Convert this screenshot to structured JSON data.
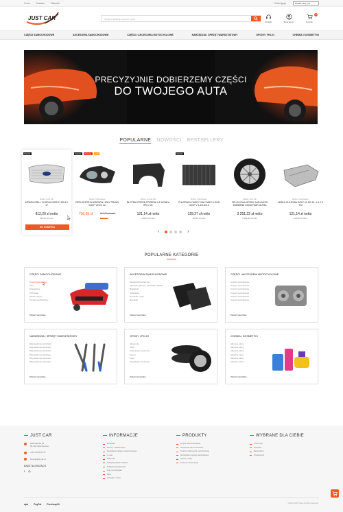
{
  "topbar": {
    "links": [
      "O nas",
      "Dostawa",
      "Płatności"
    ],
    "language": "Zmień język",
    "currency": "Polskie złoty (zł)"
  },
  "header": {
    "logo_text": "JUST CAR",
    "search_placeholder": "Szukaj w katalogu naszych części...",
    "icons": [
      {
        "icon": "headset-icon",
        "label": "Kontakt"
      },
      {
        "icon": "user-icon",
        "label": "Moje konto"
      },
      {
        "icon": "cart-icon",
        "label": "Koszyk",
        "badge": "0"
      }
    ]
  },
  "nav": {
    "items": [
      "CZĘŚCI SAMOCHODOWE",
      "AKCESORIA SAMOCHODOWE",
      "CZĘŚCI I AKCESORIA MOTOCYKLOWE",
      "NARZĘDZIA I SPRZĘT WARSZTATOWY",
      "OPONY I FELGI",
      "CHEMIA I KOSMETYKI"
    ]
  },
  "banner": {
    "line1": "PRECYZYJNIE DOBIERZEMY CZĘŚCI",
    "line2": "DO TWOJEGO AUTA"
  },
  "product_tabs": [
    "POPULARNE",
    "NOWOŚCI",
    "BESTSELLERY"
  ],
  "products": [
    {
      "tags": [
        "Nowość"
      ],
      "brand": "Marka: Ford OE",
      "name": "ATRAPA GRILL CHROM FORD F-150 15-17",
      "price": "812,20 zł netto",
      "gross": "999,01 zł brutto",
      "cart": "DO KOSZYKA"
    },
    {
      "tags": [
        "Nowość",
        "Promocja",
        "-15%"
      ],
      "brand": "Marka: Volkswagen",
      "name": "REFLEKTOR BI-KSENON LEWY PRAWY GOLF VII 5G 12-",
      "price": "736,99 zł",
      "old_price": "812,20 zł netto",
      "old_gross": "999,01 zł"
    },
    {
      "tags": [],
      "brand": "Marka: Honda OE",
      "name": "BŁOTNIK PRZÓD PRZEDNI L/P HONDA HR-V 15-",
      "price": "121,14 zł netto",
      "gross": "149,00 zł brutto"
    },
    {
      "tags": [
        "Nowość"
      ],
      "brand": "Marka: Volkswagen",
      "name": "CHŁODNICA WODY VW CADDY LEON GOLF V 1.4/1.6/2.0",
      "price": "129,27 zł netto",
      "gross": "159,00 zł brutto"
    },
    {
      "tags": [],
      "brand": "Marka: Audi OE",
      "name": "FELGI KOŁA OPONY AUDI A8 D5 235/55R18 GOODYEAR ULTRA",
      "price": "3 251,22 zł netto",
      "gross": "3 999,00 zł brutto"
    },
    {
      "tags": [],
      "brand": "Marka: Volkswagen",
      "name": "MISKA OLEJOWA GOLF VII 5G 12- 1.4 2.0 TDI",
      "price": "121,14 zł netto",
      "gross": "149,00 zł brutto"
    }
  ],
  "categories_title": "POPULARNE KATEGORIE",
  "categories": [
    {
      "title": "CZĘŚCI SAMOCHODOWE",
      "items": [
        "Części blacharskie",
        "Filtry",
        "Oświetlenie",
        "Pozostałe",
        "Silniki i części",
        "Tuning mechaniczny"
      ],
      "all": "Zobacz wszystkie"
    },
    {
      "title": "AKCESORIA SAMOCHODOWE",
      "items": [
        "Akcesoria zewnętrzne",
        "Apteczki, gaśnice, kamizelki, trójkąty",
        "Bagażniki",
        "Chlapacze",
        "Dywaniki i maty",
        "Dywaniki"
      ],
      "all": "Zobacz wszystkie"
    },
    {
      "title": "CZĘŚCI I AKCESORIA MOTOCYKLOWE",
      "items": [
        "Części motocyklowe",
        "Części motocyklowe",
        "Części motocyklowe",
        "Części motocyklowe",
        "Części motocyklowe",
        "Części motocyklowe"
      ],
      "all": "Zobacz wszystkie"
    },
    {
      "title": "NARZĘDZIA I SPRZĘT WARSZTATOWY",
      "items": [
        "Wyposażenie warsztatu",
        "Wyposażenie warsztatu",
        "Wyposażenie warsztatu",
        "Wyposażenie warsztatu",
        "Wyposażenie warsztatu",
        "Wyposażenie warsztatu"
      ],
      "all": "Zobacz wszystkie"
    },
    {
      "title": "OPONY I FELGI",
      "items": [
        "Akcesoria",
        "Felgi",
        "Koła (felgi z oponami)",
        "Opony",
        "Felgi",
        "Koła (felgi z oponami)"
      ],
      "all": "Zobacz wszystkie"
    },
    {
      "title": "CHEMIA I KOSMETYKI",
      "items": [
        "Aktywne piany",
        "Aktywne piany",
        "Aktywne piany",
        "Aktywne piany",
        "Aktywne piany",
        "Aktywne piany"
      ],
      "all": "Zobacz wszystkie"
    }
  ],
  "footer": {
    "company": {
      "title": "JUST CAR",
      "address1": "Bukowiecka 56",
      "address2": "86-300 Skierniewice",
      "phone": "+48 799 364 374",
      "email": "biuro@just-car.pl",
      "follow": "BĄDŹ NA BIEŻĄCO"
    },
    "info": {
      "title": "INFORMACJE",
      "items": [
        "Dostawa",
        "Zwroty i Reklamacje",
        "Regulamin sklepu internetowego",
        "O nas",
        "Płatności",
        "Polityka plików cookies",
        "Polityka prywatności",
        "Kup na Kamyam",
        "Blog",
        "Kontakt z nami"
      ]
    },
    "products": {
      "title": "PRODUKTY",
      "items": [
        "Części samochodowe",
        "Akcesoria samochodowe",
        "Części i akcesoria motocyklowe",
        "Narzędzia i sprzęt warsztatowy",
        "Opony i felgi",
        "Chemia i kosmetyki"
      ]
    },
    "choose": {
      "title": "WYBRANE DLA CIEBIE",
      "items": [
        "Promocje",
        "Nowości",
        "Bestsellery",
        "Producenci"
      ]
    },
    "payments": [
      "dpd",
      "PayPal",
      "Przelewy24"
    ],
    "copyright": "© 2021 JUST CAR. All rights reserved."
  },
  "colors": {
    "accent": "#ef5a24",
    "dark": "#222222"
  }
}
